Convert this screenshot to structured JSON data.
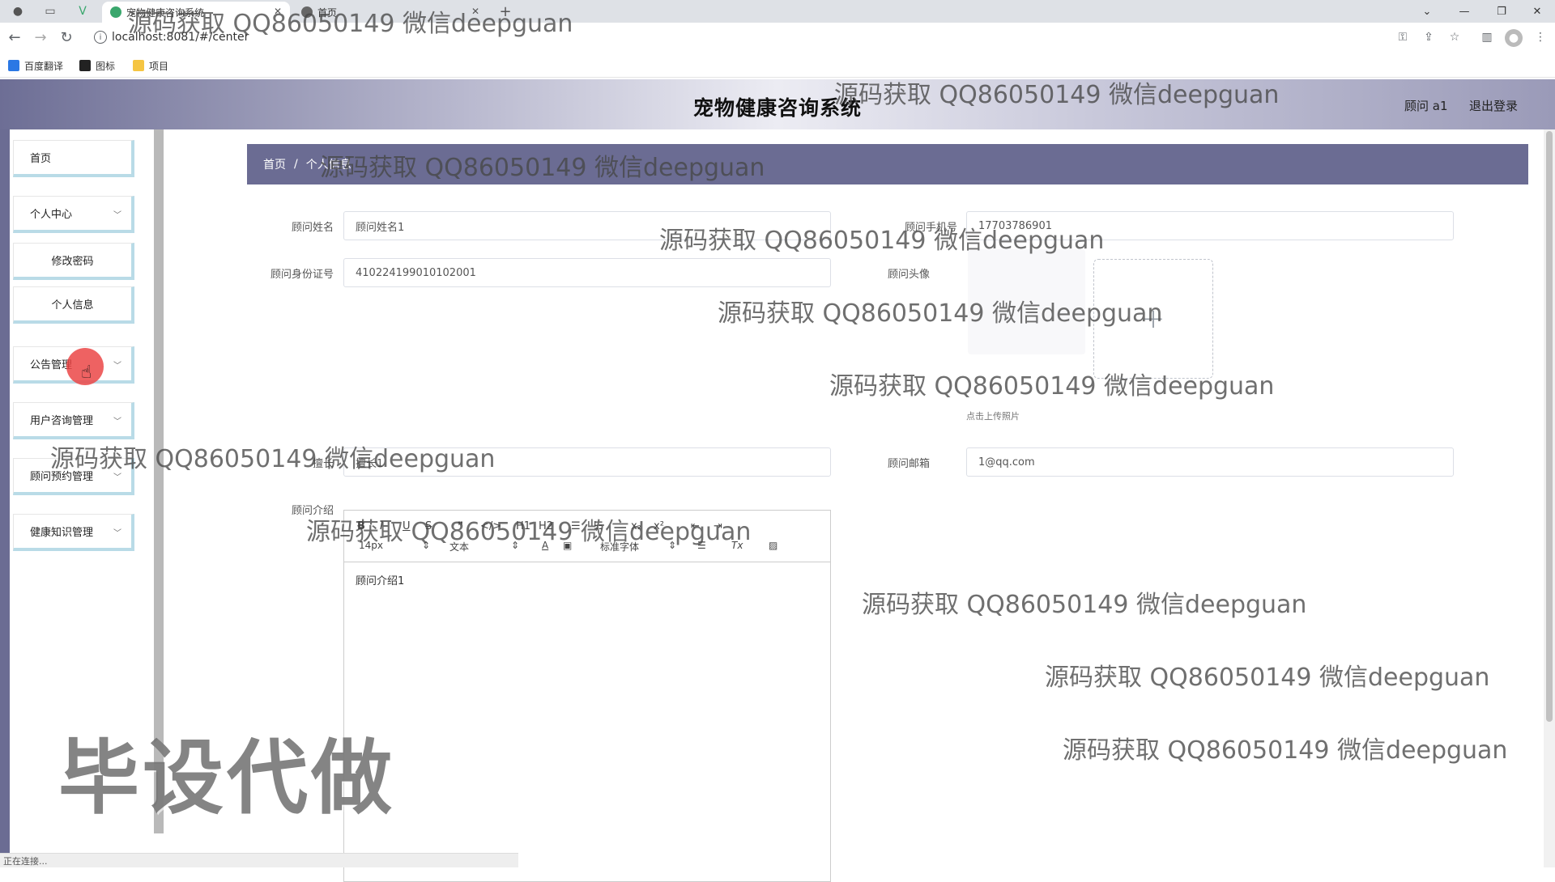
{
  "browser": {
    "tabs": [
      {
        "title": "宠物健康咨询系统",
        "active": true
      },
      {
        "title": "首页",
        "active": false
      }
    ],
    "url": "localhost:8081/#/center",
    "bookmarks": [
      "百度翻译",
      "图标",
      "项目"
    ],
    "status_text": "正在连接..."
  },
  "app": {
    "title": "宠物健康咨询系统",
    "user_label": "顾问 a1",
    "logout_label": "退出登录"
  },
  "sidebar": {
    "items": [
      {
        "label": "首页",
        "expandable": false
      },
      {
        "label": "个人中心",
        "expandable": true
      },
      {
        "label": "修改密码",
        "expandable": false
      },
      {
        "label": "个人信息",
        "expandable": false
      },
      {
        "label": "公告管理",
        "expandable": true
      },
      {
        "label": "用户咨询管理",
        "expandable": true
      },
      {
        "label": "顾问预约管理",
        "expandable": true
      },
      {
        "label": "健康知识管理",
        "expandable": true
      }
    ]
  },
  "breadcrumb": {
    "home": "首页",
    "separator": "/",
    "current": "个人信息"
  },
  "form": {
    "name_label": "顾问姓名",
    "name_value": "顾问姓名1",
    "phone_label": "顾问手机号",
    "phone_value": "17703786901",
    "idcard_label": "顾问身份证号",
    "idcard_value": "410224199010102001",
    "avatar_label": "顾问头像",
    "upload_plus": "+",
    "upload_tip": "点击上传照片",
    "specialty_label": "擅长",
    "specialty_value": "擅长1",
    "email_label": "顾问邮箱",
    "email_value": "1@qq.com",
    "intro_label": "顾问介绍",
    "editor": {
      "buttons": [
        "B",
        "I",
        "U",
        "S",
        "❞",
        "</>",
        "H1",
        "H2",
        "☰",
        "☷",
        "x₂",
        "x²",
        "⇤",
        "⇥"
      ],
      "font_size": "14px",
      "header_select": "文本",
      "font_family": "标准字体",
      "content": "顾问介绍1"
    }
  },
  "watermarks": {
    "small": "源码获取 QQ86050149 微信deepguan",
    "big": "毕设代做"
  },
  "colors": {
    "theme": "#6b6c93",
    "menu_border": "#b9dbe7"
  }
}
